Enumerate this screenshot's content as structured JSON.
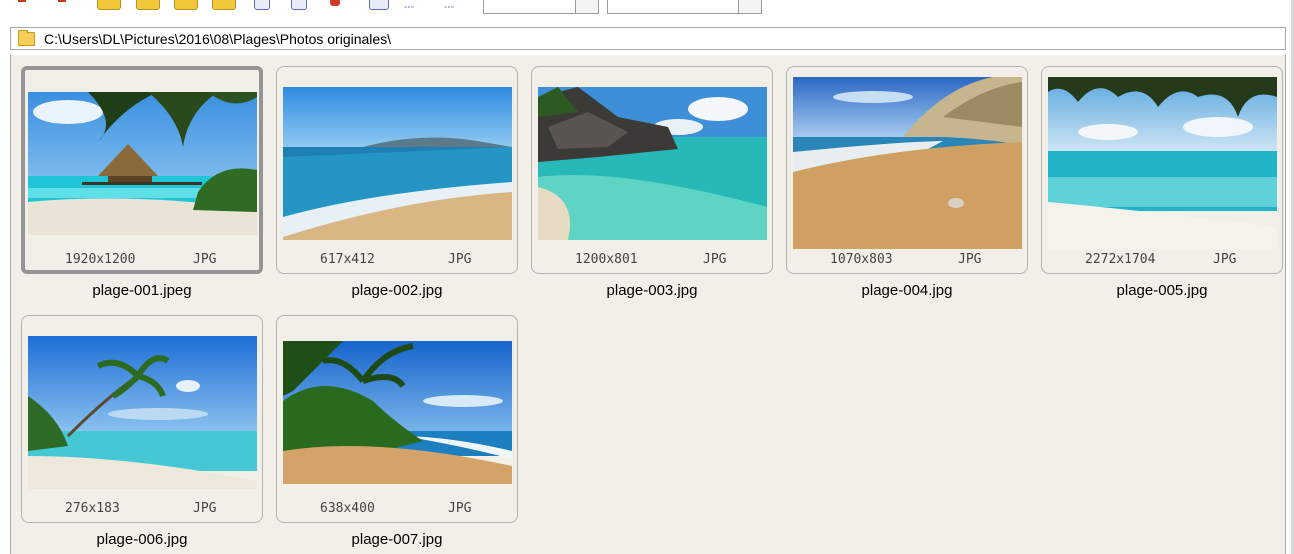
{
  "path": "C:\\Users\\DL\\Pictures\\2016\\08\\Plages\\Photos originales\\",
  "files": [
    {
      "name": "plage-001.jpeg",
      "dims": "1920x1200",
      "type": "JPG",
      "selected": true
    },
    {
      "name": "plage-002.jpg",
      "dims": "617x412",
      "type": "JPG"
    },
    {
      "name": "plage-003.jpg",
      "dims": "1200x801",
      "type": "JPG"
    },
    {
      "name": "plage-004.jpg",
      "dims": "1070x803",
      "type": "JPG"
    },
    {
      "name": "plage-005.jpg",
      "dims": "2272x1704",
      "type": "JPG"
    },
    {
      "name": "plage-006.jpg",
      "dims": "276x183",
      "type": "JPG"
    },
    {
      "name": "plage-007.jpg",
      "dims": "638x400",
      "type": "JPG"
    }
  ],
  "colors": {
    "view_background": "#f1efe7",
    "selection_border": "#959595",
    "card_border": "#b3b3b3",
    "folder": "#f3cf5a"
  }
}
